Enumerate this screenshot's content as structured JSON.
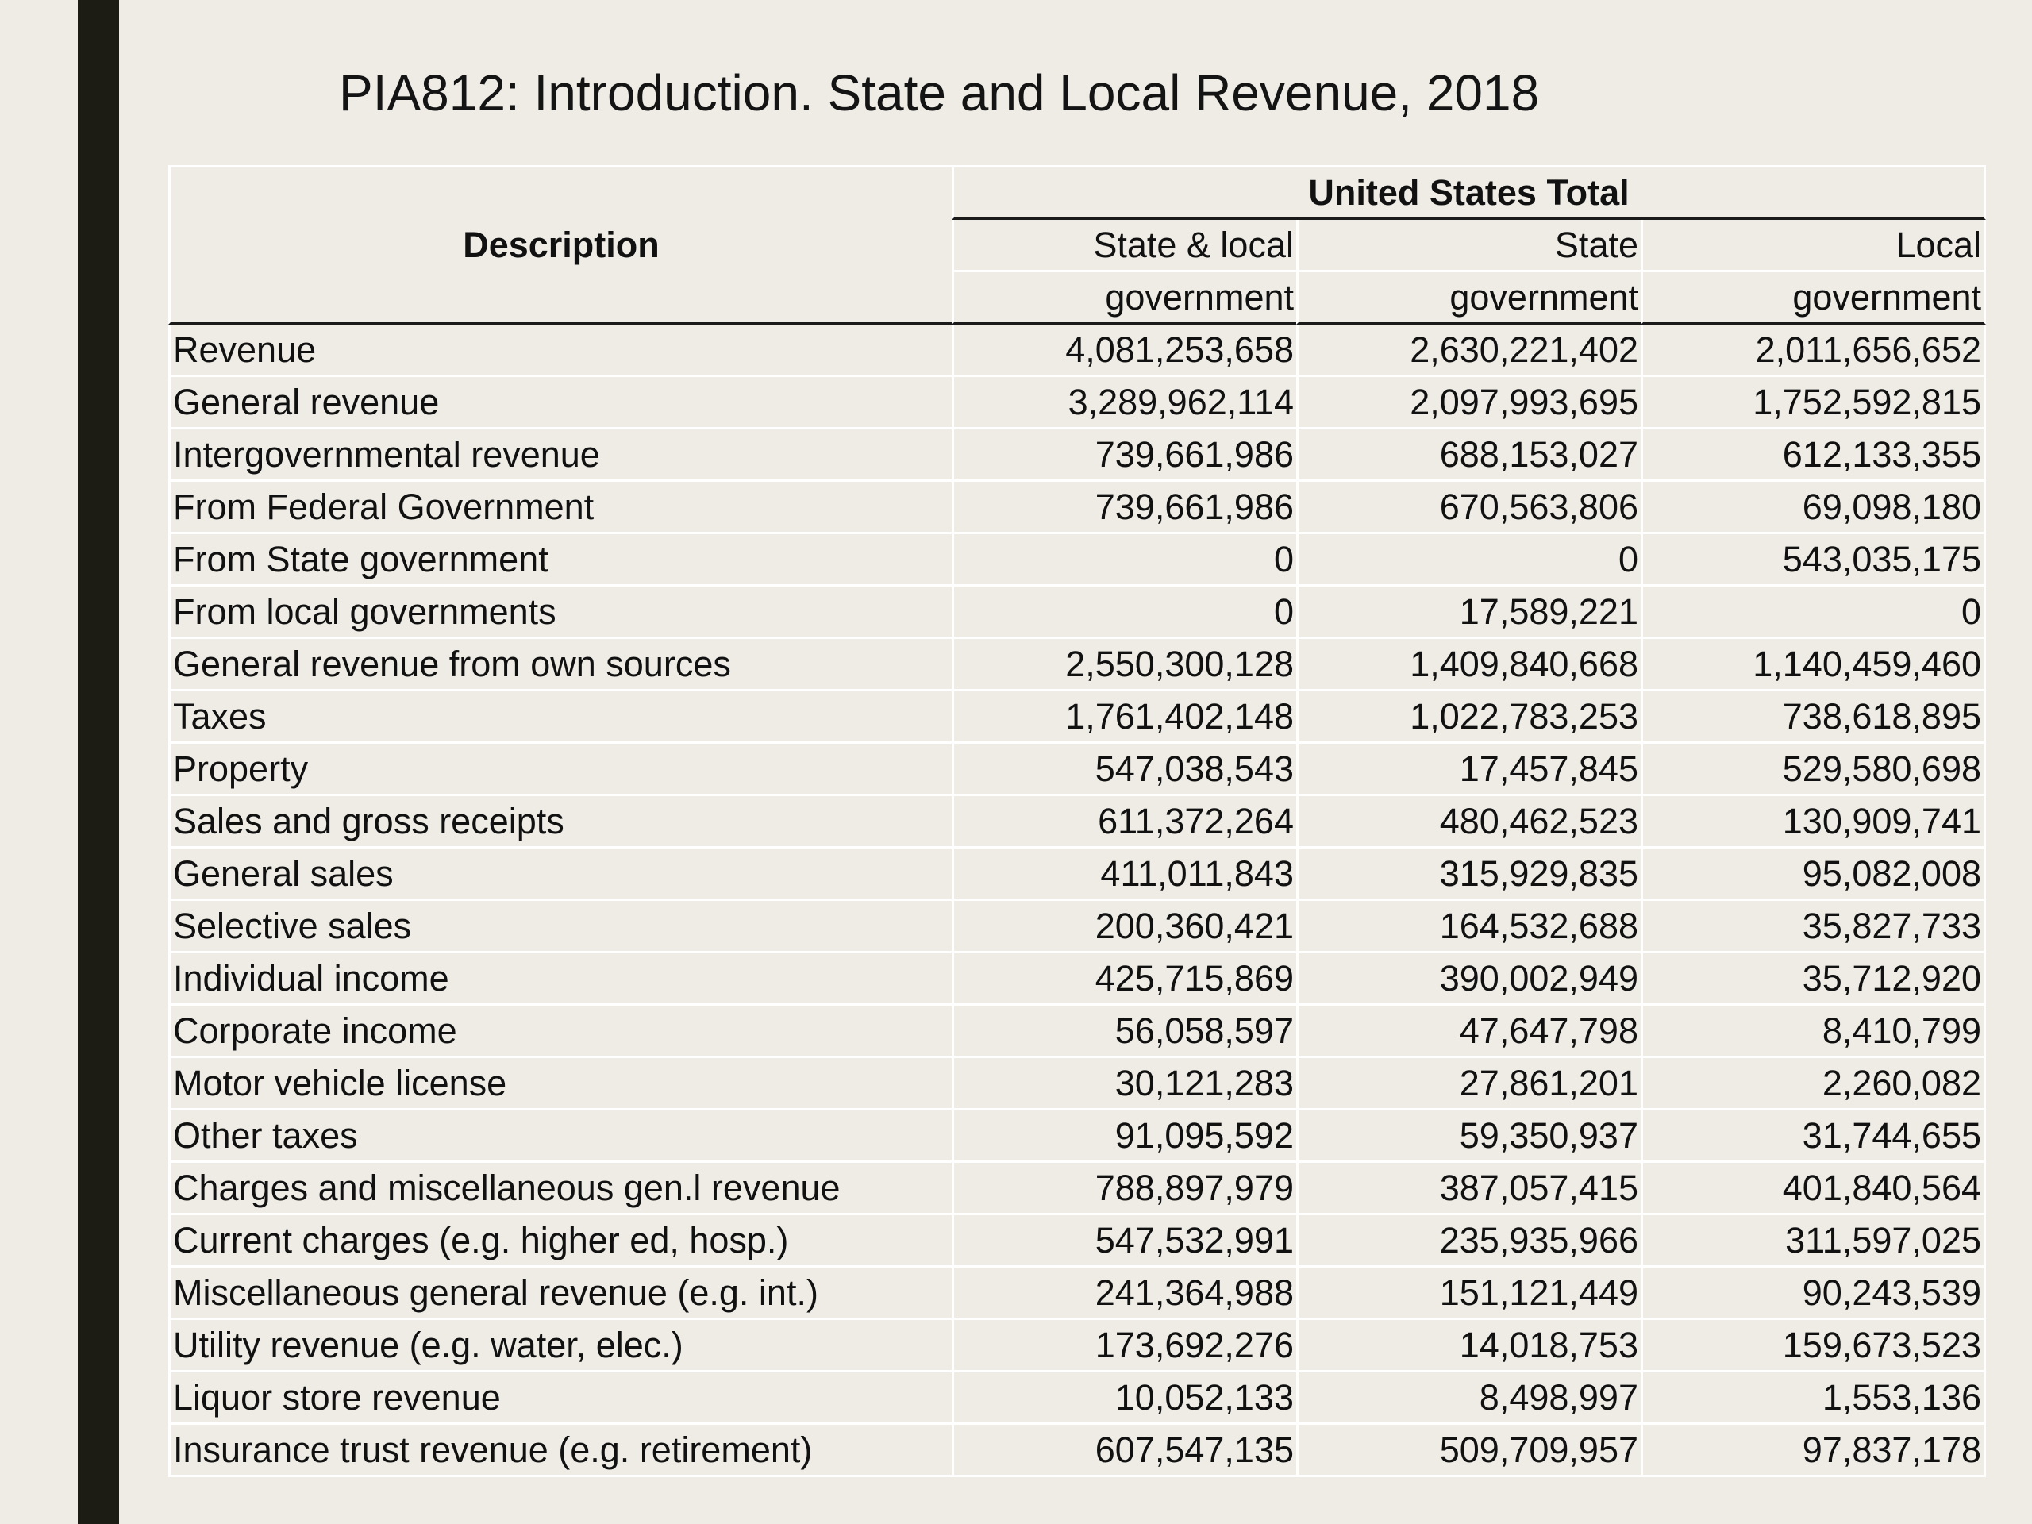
{
  "title": "PIA812: Introduction.  State and Local Revenue, 2018",
  "table": {
    "description_header": "Description",
    "group_header": "United States Total",
    "columns": [
      {
        "line1": "State & local",
        "line2": "government"
      },
      {
        "line1": "State",
        "line2": "government"
      },
      {
        "line1": "Local",
        "line2": "government"
      }
    ],
    "rows": [
      {
        "label": "Revenue",
        "indent": 0,
        "values": [
          "4,081,253,658",
          "2,630,221,402",
          "2,011,656,652"
        ]
      },
      {
        "label": "General revenue",
        "indent": 0,
        "values": [
          "3,289,962,114",
          "2,097,993,695",
          "1,752,592,815"
        ]
      },
      {
        "label": "Intergovernmental revenue",
        "indent": 1,
        "values": [
          "739,661,986",
          "688,153,027",
          "612,133,355"
        ]
      },
      {
        "label": "From Federal Government",
        "indent": 2,
        "values": [
          "739,661,986",
          "670,563,806",
          "69,098,180"
        ]
      },
      {
        "label": "From State government",
        "indent": 2,
        "values": [
          "0",
          "0",
          "543,035,175"
        ]
      },
      {
        "label": "From local governments",
        "indent": 2,
        "values": [
          "0",
          "17,589,221",
          "0"
        ]
      },
      {
        "label": "General revenue from own sources",
        "indent": 1,
        "values": [
          "2,550,300,128",
          "1,409,840,668",
          "1,140,459,460"
        ]
      },
      {
        "label": "Taxes",
        "indent": 2,
        "values": [
          "1,761,402,148",
          "1,022,783,253",
          "738,618,895"
        ]
      },
      {
        "label": "Property",
        "indent": 3,
        "values": [
          "547,038,543",
          "17,457,845",
          "529,580,698"
        ]
      },
      {
        "label": "Sales and gross receipts",
        "indent": 3,
        "values": [
          "611,372,264",
          "480,462,523",
          "130,909,741"
        ]
      },
      {
        "label": "General sales",
        "indent": 4,
        "values": [
          "411,011,843",
          "315,929,835",
          "95,082,008"
        ]
      },
      {
        "label": "Selective sales",
        "indent": 4,
        "values": [
          "200,360,421",
          "164,532,688",
          "35,827,733"
        ]
      },
      {
        "label": "Individual income",
        "indent": 3,
        "values": [
          "425,715,869",
          "390,002,949",
          "35,712,920"
        ]
      },
      {
        "label": "Corporate income",
        "indent": 3,
        "values": [
          "56,058,597",
          "47,647,798",
          "8,410,799"
        ]
      },
      {
        "label": "Motor vehicle license",
        "indent": 3,
        "values": [
          "30,121,283",
          "27,861,201",
          "2,260,082"
        ]
      },
      {
        "label": "Other taxes",
        "indent": 3,
        "values": [
          "91,095,592",
          "59,350,937",
          "31,744,655"
        ]
      },
      {
        "label": "Charges and miscellaneous gen.l revenue",
        "indent": 2,
        "values": [
          "788,897,979",
          "387,057,415",
          "401,840,564"
        ]
      },
      {
        "label": "Current charges (e.g. higher ed, hosp.)",
        "indent": 3,
        "values": [
          "547,532,991",
          "235,935,966",
          "311,597,025"
        ]
      },
      {
        "label": "Miscellaneous general revenue (e.g. int.)",
        "indent": 3,
        "values": [
          "241,364,988",
          "151,121,449",
          "90,243,539"
        ]
      },
      {
        "label": "Utility revenue (e.g. water, elec.)",
        "indent": 0,
        "values": [
          "173,692,276",
          "14,018,753",
          "159,673,523"
        ]
      },
      {
        "label": "Liquor store revenue",
        "indent": 0,
        "values": [
          "10,052,133",
          "8,498,997",
          "1,553,136"
        ]
      },
      {
        "label": "Insurance trust revenue (e.g. retirement)",
        "indent": 0,
        "values": [
          "607,547,135",
          "509,709,957",
          "97,837,178"
        ]
      }
    ]
  }
}
